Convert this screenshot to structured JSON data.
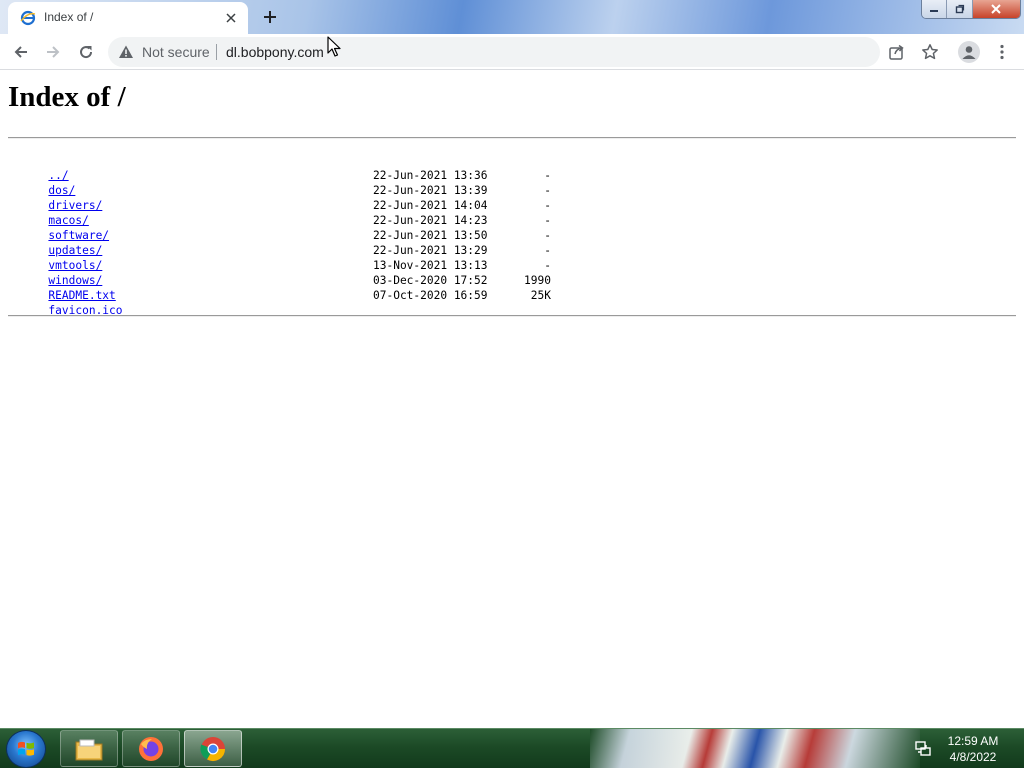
{
  "browser": {
    "tab": {
      "title": "Index of /",
      "favicon": "ie-favicon-icon"
    },
    "omnibox": {
      "security_text": "Not secure",
      "url": "dl.bobpony.com"
    }
  },
  "page": {
    "title": "Index of /",
    "parent_link": "../",
    "entries": [
      {
        "name": "dos/",
        "date": "22-Jun-2021 13:36",
        "size": "-"
      },
      {
        "name": "drivers/",
        "date": "22-Jun-2021 13:39",
        "size": "-"
      },
      {
        "name": "macos/",
        "date": "22-Jun-2021 14:04",
        "size": "-"
      },
      {
        "name": "software/",
        "date": "22-Jun-2021 14:23",
        "size": "-"
      },
      {
        "name": "updates/",
        "date": "22-Jun-2021 13:50",
        "size": "-"
      },
      {
        "name": "vmtools/",
        "date": "22-Jun-2021 13:29",
        "size": "-"
      },
      {
        "name": "windows/",
        "date": "13-Nov-2021 13:13",
        "size": "-"
      },
      {
        "name": "README.txt",
        "date": "03-Dec-2020 17:52",
        "size": "1990"
      },
      {
        "name": "favicon.ico",
        "date": "07-Oct-2020 16:59",
        "size": "25K"
      }
    ]
  },
  "taskbar": {
    "clock_time": "12:59 AM",
    "clock_date": "4/8/2022",
    "items": [
      "file-explorer-icon",
      "firefox-icon",
      "chrome-icon"
    ]
  },
  "colors": {
    "link": "#0000ee",
    "taskbar": "#1c4a26",
    "omnibox_bg": "#f1f3f4"
  }
}
